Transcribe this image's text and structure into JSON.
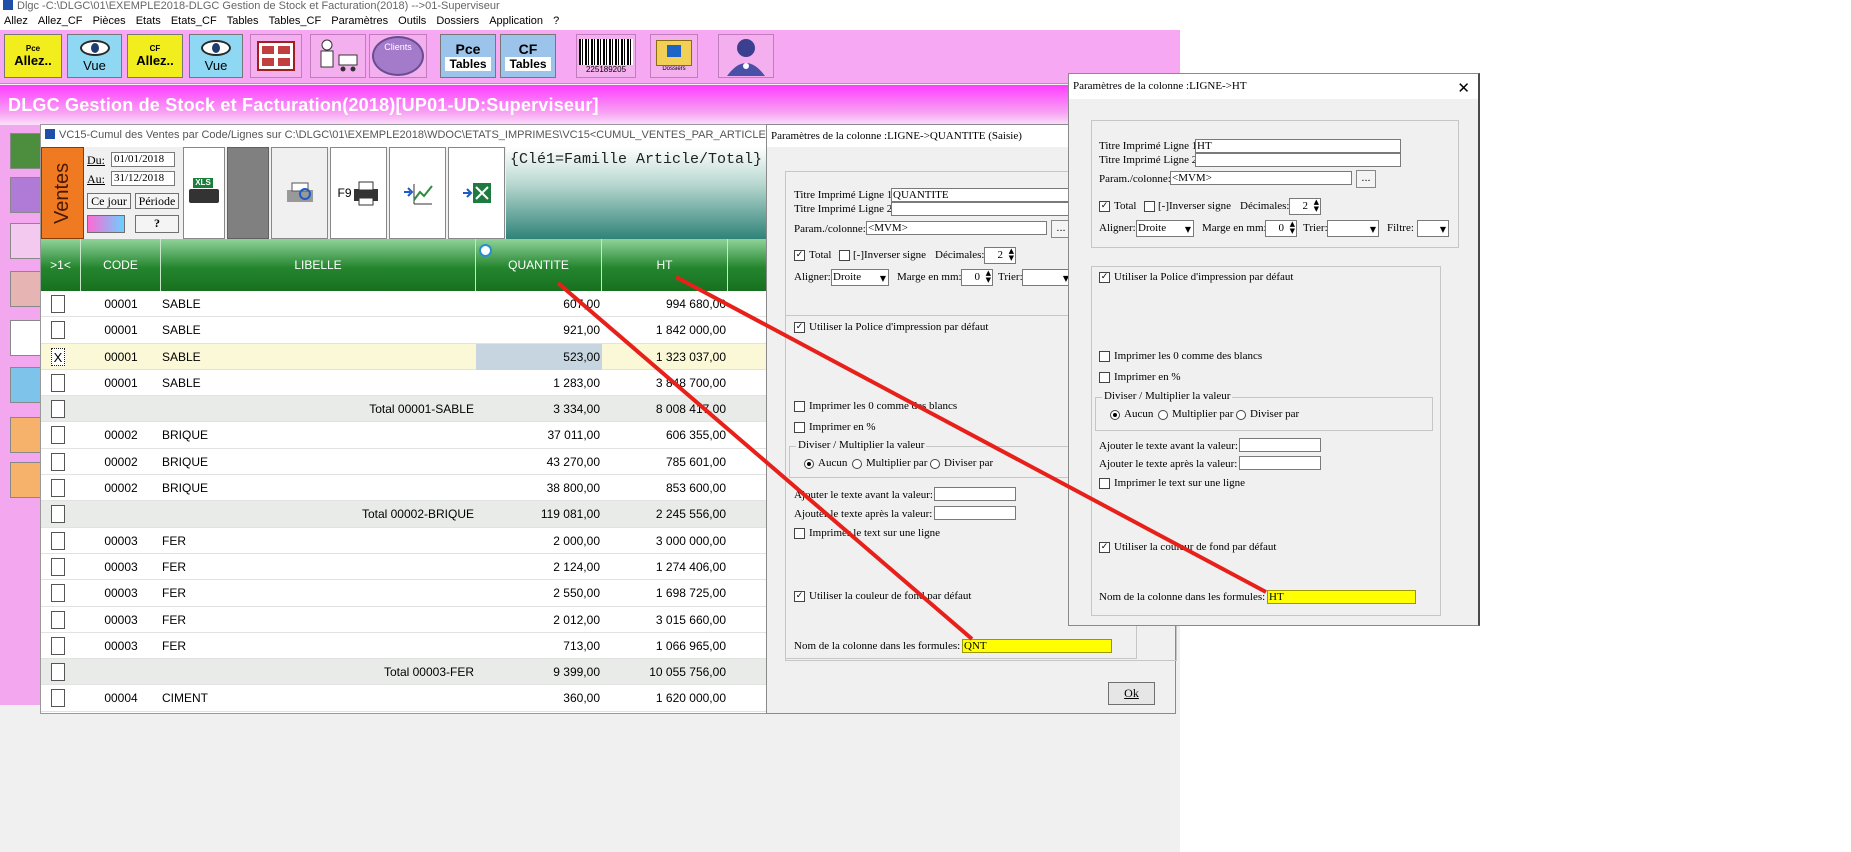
{
  "app": {
    "window_title": "Dlgc -C:\\DLGC\\01\\EXEMPLE2018-DLGC Gestion de Stock et Facturation(2018) -->01-Superviseur",
    "menu": [
      "Allez",
      "Allez_CF",
      "Pièces",
      "Etats",
      "Etats_CF",
      "Tables",
      "Tables_CF",
      "Paramètres",
      "Outils",
      "Dossiers",
      "Application",
      "?"
    ],
    "toolbar": {
      "allez_pce_sup": "Pce",
      "allez_label": "Allez..",
      "vue_label": "Vue",
      "allez_cf_sup": "CF",
      "clients_label": "Clients",
      "pce_tables_top": "Pce",
      "pce_tables_bottom": "Tables",
      "cf_tables_top": "CF",
      "cf_tables_bottom": "Tables",
      "barcode_number": "225189205",
      "dossiers_label": "Dossiers"
    },
    "banner_title": "DLGC Gestion de Stock et Facturation(2018)[UP01-UD:Superviseur]"
  },
  "report_window": {
    "title": "VC15-Cumul des Ventes par Code/Lignes sur C:\\DLGC\\01\\EXEMPLE2018\\WDOC\\ETATS_IMPRIMES\\VC15<CUMUL_VENTES_PAR_ARTICLE.DPL>",
    "ventes_label": "Ventes",
    "du_label": "Du:",
    "du_value": "01/01/2018",
    "au_label": "Au:",
    "au_value": "31/12/2018",
    "ce_jour_button": "Ce jour",
    "periode_button": "Période",
    "help_button": "?",
    "xls_label": "XLS",
    "f9_label": "F9",
    "key_label": "{Clé1=Famille Article/Total}",
    "columns": {
      "select": ">1<",
      "code": "CODE",
      "libelle": "LIBELLE",
      "quantite": "QUANTITE",
      "ht": "HT"
    },
    "rows": [
      {
        "mark": "",
        "code": "00001",
        "libelle": "SABLE",
        "quantite": "607,00",
        "ht": "994 680,00",
        "type": "line"
      },
      {
        "mark": "",
        "code": "00001",
        "libelle": "SABLE",
        "quantite": "921,00",
        "ht": "1 842 000,00",
        "type": "line"
      },
      {
        "mark": "X",
        "code": "00001",
        "libelle": "SABLE",
        "quantite": "523,00",
        "ht": "1 323 037,00",
        "type": "selected"
      },
      {
        "mark": "",
        "code": "00001",
        "libelle": "SABLE",
        "quantite": "1 283,00",
        "ht": "3 848 700,00",
        "type": "line"
      },
      {
        "mark": "",
        "code": "",
        "libelle": "Total 00001-SABLE",
        "quantite": "3 334,00",
        "ht": "8 008 417,00",
        "type": "total"
      },
      {
        "mark": "",
        "code": "00002",
        "libelle": "BRIQUE",
        "quantite": "37 011,00",
        "ht": "606 355,00",
        "type": "line"
      },
      {
        "mark": "",
        "code": "00002",
        "libelle": "BRIQUE",
        "quantite": "43 270,00",
        "ht": "785 601,00",
        "type": "line"
      },
      {
        "mark": "",
        "code": "00002",
        "libelle": "BRIQUE",
        "quantite": "38 800,00",
        "ht": "853 600,00",
        "type": "line"
      },
      {
        "mark": "",
        "code": "",
        "libelle": "Total 00002-BRIQUE",
        "quantite": "119 081,00",
        "ht": "2 245 556,00",
        "type": "total"
      },
      {
        "mark": "",
        "code": "00003",
        "libelle": "FER",
        "quantite": "2 000,00",
        "ht": "3 000 000,00",
        "type": "line"
      },
      {
        "mark": "",
        "code": "00003",
        "libelle": "FER",
        "quantite": "2 124,00",
        "ht": "1 274 406,00",
        "type": "line"
      },
      {
        "mark": "",
        "code": "00003",
        "libelle": "FER",
        "quantite": "2 550,00",
        "ht": "1 698 725,00",
        "type": "line"
      },
      {
        "mark": "",
        "code": "00003",
        "libelle": "FER",
        "quantite": "2 012,00",
        "ht": "3 015 660,00",
        "type": "line"
      },
      {
        "mark": "",
        "code": "00003",
        "libelle": "FER",
        "quantite": "713,00",
        "ht": "1 066 965,00",
        "type": "line"
      },
      {
        "mark": "",
        "code": "",
        "libelle": "Total 00003-FER",
        "quantite": "9 399,00",
        "ht": "10 055 756,00",
        "type": "total"
      },
      {
        "mark": "",
        "code": "00004",
        "libelle": "CIMENT",
        "quantite": "360,00",
        "ht": "1 620 000,00",
        "type": "line"
      }
    ]
  },
  "dialog_quantite": {
    "title": "Paramètres de la colonne :LIGNE->QUANTITE (Saisie)",
    "titre_ligne1_label": "Titre Imprimé Ligne 1:",
    "titre_ligne1_value": "QUANTITE",
    "titre_ligne2_label": "Titre Imprimé Ligne 2:",
    "titre_ligne2_value": "",
    "param_colonne_label": "Param./colonne:",
    "param_colonne_value": "<MVM>",
    "dots_button": "...",
    "total_label": "Total",
    "total_checked": "✓",
    "inverser_label": "[-]Inverser signe",
    "decimales_label": "Décimales:",
    "decimales_value": "2",
    "aligner_label": "Aligner:",
    "aligner_value": "Droite",
    "marge_label": "Marge en mm:",
    "marge_value": "0",
    "trier_label": "Trier:",
    "trier_value": "",
    "police_label": "Utiliser la Police d'impression par défaut",
    "police_checked": "✓",
    "zeros_label": "Imprimer les 0 comme des blancs",
    "pct_label": "Imprimer en %",
    "diviser_group": "Diviser / Multiplier la valeur",
    "aucun_label": "Aucun",
    "multiplier_label": "Multiplier par",
    "diviser_label": "Diviser par",
    "texte_avant_label": "Ajouter le texte avant la valeur:",
    "texte_apres_label": "Ajouter le texte après la valeur:",
    "text_ligne_label": "Imprimer le text sur une ligne",
    "couleur_label": "Utiliser la couleur de fond  par défaut",
    "couleur_checked": "✓",
    "nom_colonne_label": "Nom de la colonne dans les formules:",
    "nom_colonne_value": "QNT",
    "ok_button": "Ok"
  },
  "dialog_ht": {
    "title": "Paramètres de la colonne :LIGNE->HT",
    "close_glyph": "✕",
    "titre_ligne1_label": "Titre Imprimé Ligne 1:",
    "titre_ligne1_value": "HT",
    "titre_ligne2_label": "Titre Imprimé Ligne 2:",
    "titre_ligne2_value": "",
    "param_colonne_label": "Param./colonne:",
    "param_colonne_value": "<MVM>",
    "dots_button": "...",
    "total_label": "Total",
    "total_checked": "✓",
    "inverser_label": "[-]Inverser signe",
    "decimales_label": "Décimales:",
    "decimales_value": "2",
    "aligner_label": "Aligner:",
    "aligner_value": "Droite",
    "marge_label": "Marge en mm:",
    "marge_value": "0",
    "trier_label": "Trier:",
    "trier_value": "",
    "filtre_label": "Filtre:",
    "filtre_value": "",
    "police_label": "Utiliser la Police d'impression par défaut",
    "police_checked": "✓",
    "zeros_label": "Imprimer les 0 comme des blancs",
    "pct_label": "Imprimer en %",
    "diviser_group": "Diviser / Multiplier la valeur",
    "aucun_label": "Aucun",
    "multiplier_label": "Multiplier par",
    "diviser_label": "Diviser par",
    "texte_avant_label": "Ajouter le texte avant la valeur:",
    "texte_apres_label": "Ajouter le texte après la valeur:",
    "text_ligne_label": "Imprimer le text sur une ligne",
    "couleur_label": "Utiliser la couleur de fond  par défaut",
    "couleur_checked": "✓",
    "nom_colonne_label": "Nom de la colonne dans les formules:",
    "nom_colonne_value": "HT"
  },
  "colors": {
    "toolbar_pink": "#f6a8f2",
    "banner_magenta": "#ff3cff",
    "grid_header_green": "#25862f",
    "formula_yellow": "#ffff00",
    "annotation_red": "#e8201a",
    "ventes_orange": "#f07a22"
  }
}
